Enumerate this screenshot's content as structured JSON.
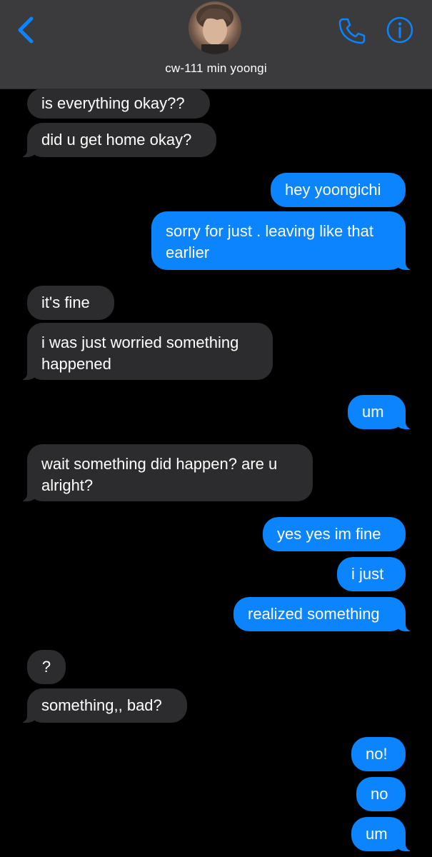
{
  "header": {
    "contact_name": "cw-111 min yoongi",
    "icons": {
      "back": "chevron-left-icon",
      "call": "phone-icon",
      "info": "info-icon"
    }
  },
  "colors": {
    "header_bg": "#3b3b3d",
    "accent": "#0b84fe",
    "incoming_bubble": "#2c2c2e",
    "outgoing_bubble": "#0b84fe",
    "background": "#000000"
  },
  "messages": [
    {
      "sender": "them",
      "text": "is everything okay??"
    },
    {
      "sender": "them",
      "text": "did u get home okay?"
    },
    {
      "sender": "me",
      "text": "hey yoongichi"
    },
    {
      "sender": "me",
      "text": "sorry for just . leaving like that earlier"
    },
    {
      "sender": "them",
      "text": "it's fine"
    },
    {
      "sender": "them",
      "text": "i was just worried something happened"
    },
    {
      "sender": "me",
      "text": "um"
    },
    {
      "sender": "them",
      "text": "wait something did happen? are u alright?"
    },
    {
      "sender": "me",
      "text": "yes yes im fine"
    },
    {
      "sender": "me",
      "text": "i just"
    },
    {
      "sender": "me",
      "text": "realized something"
    },
    {
      "sender": "them",
      "text": "?"
    },
    {
      "sender": "them",
      "text": "something,, bad?"
    },
    {
      "sender": "me",
      "text": "no!"
    },
    {
      "sender": "me",
      "text": "no"
    },
    {
      "sender": "me",
      "text": "um"
    }
  ]
}
